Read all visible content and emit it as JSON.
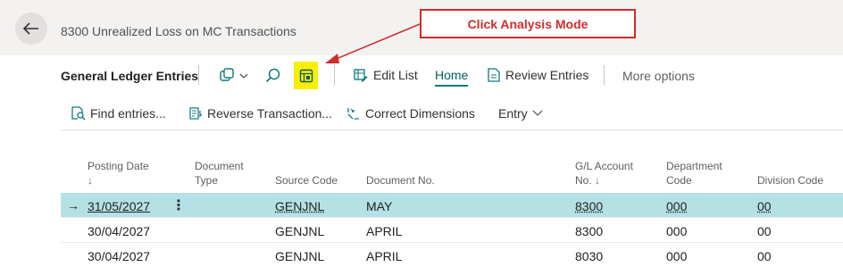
{
  "header": {
    "page_title": "8300 Unrealized Loss on MC Transactions"
  },
  "annotation": {
    "callout_text": "Click Analysis Mode",
    "color": "#d12c2c"
  },
  "action_bar": {
    "entity_title": "General Ledger Entries",
    "edit_list_label": "Edit List",
    "home_label": "Home",
    "review_entries_label": "Review Entries",
    "more_options_label": "More options",
    "highlight_color": "#f7f000"
  },
  "sub_bar": {
    "find_entries_label": "Find entries...",
    "reverse_label": "Reverse Transaction...",
    "correct_dimensions_label": "Correct Dimensions",
    "entry_label": "Entry"
  },
  "grid": {
    "columns": {
      "posting_date": [
        "Posting Date",
        "↓"
      ],
      "document_type": [
        "Document",
        "Type"
      ],
      "source_code": "Source Code",
      "document_no": "Document No.",
      "gl_account": [
        "G/L Account",
        "No. ↓"
      ],
      "department": [
        "Department",
        "Code"
      ],
      "division": "Division Code"
    },
    "rows": [
      {
        "posting_date": "31/05/2027",
        "source_code": "GENJNL",
        "document_no": "MAY",
        "gl_account": "8300",
        "department": "000",
        "division": "00"
      },
      {
        "posting_date": "30/04/2027",
        "source_code": "GENJNL",
        "document_no": "APRIL",
        "gl_account": "8300",
        "department": "000",
        "division": "00"
      },
      {
        "posting_date": "30/04/2027",
        "source_code": "GENJNL",
        "document_no": "APRIL",
        "gl_account": "8030",
        "department": "000",
        "division": "00"
      }
    ],
    "selected_row_color": "#b4e1e6"
  }
}
